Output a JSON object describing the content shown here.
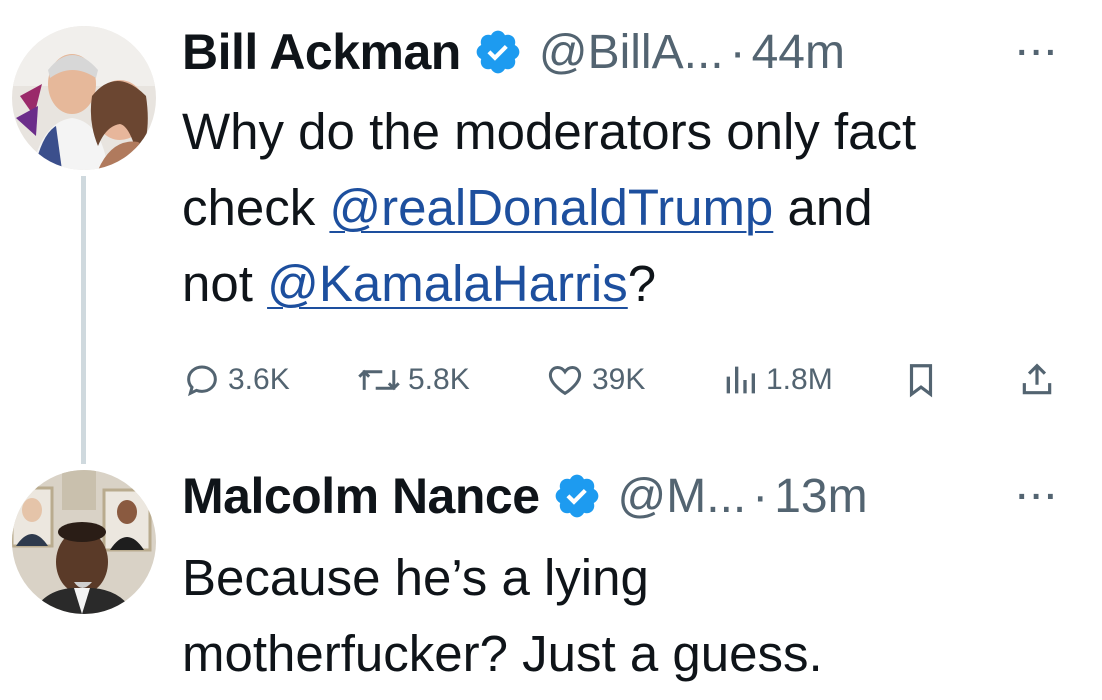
{
  "tweet1": {
    "author_name": "Bill Ackman",
    "handle": "@BillA...",
    "separator": "·",
    "time": "44m",
    "text_parts": {
      "line1": "Why do the moderators only fact",
      "line2_pre": "check ",
      "mention1": "@realDonaldTrump",
      "line2_post": " and",
      "line3_pre": "not ",
      "mention2": "@KamalaHarris",
      "line3_post": "?"
    },
    "stats": {
      "replies": "3.6K",
      "reposts": "5.8K",
      "likes": "39K",
      "views": "1.8M"
    },
    "more_label": "···"
  },
  "tweet2": {
    "author_name": "Malcolm Nance",
    "handle": "@M...",
    "separator": "·",
    "time": "13m",
    "text_parts": {
      "line1": "Because he’s a lying",
      "line2": "motherfucker? Just a guess."
    },
    "more_label": "···"
  },
  "colors": {
    "verified_badge": "#1d9bf0",
    "mention_link": "#1d4f9e",
    "secondary_text": "#536471",
    "thread_line": "#cfd9de"
  },
  "icons": [
    "verified-badge-icon",
    "reply-icon",
    "repost-icon",
    "like-icon",
    "views-icon",
    "bookmark-icon",
    "share-icon",
    "more-icon"
  ]
}
